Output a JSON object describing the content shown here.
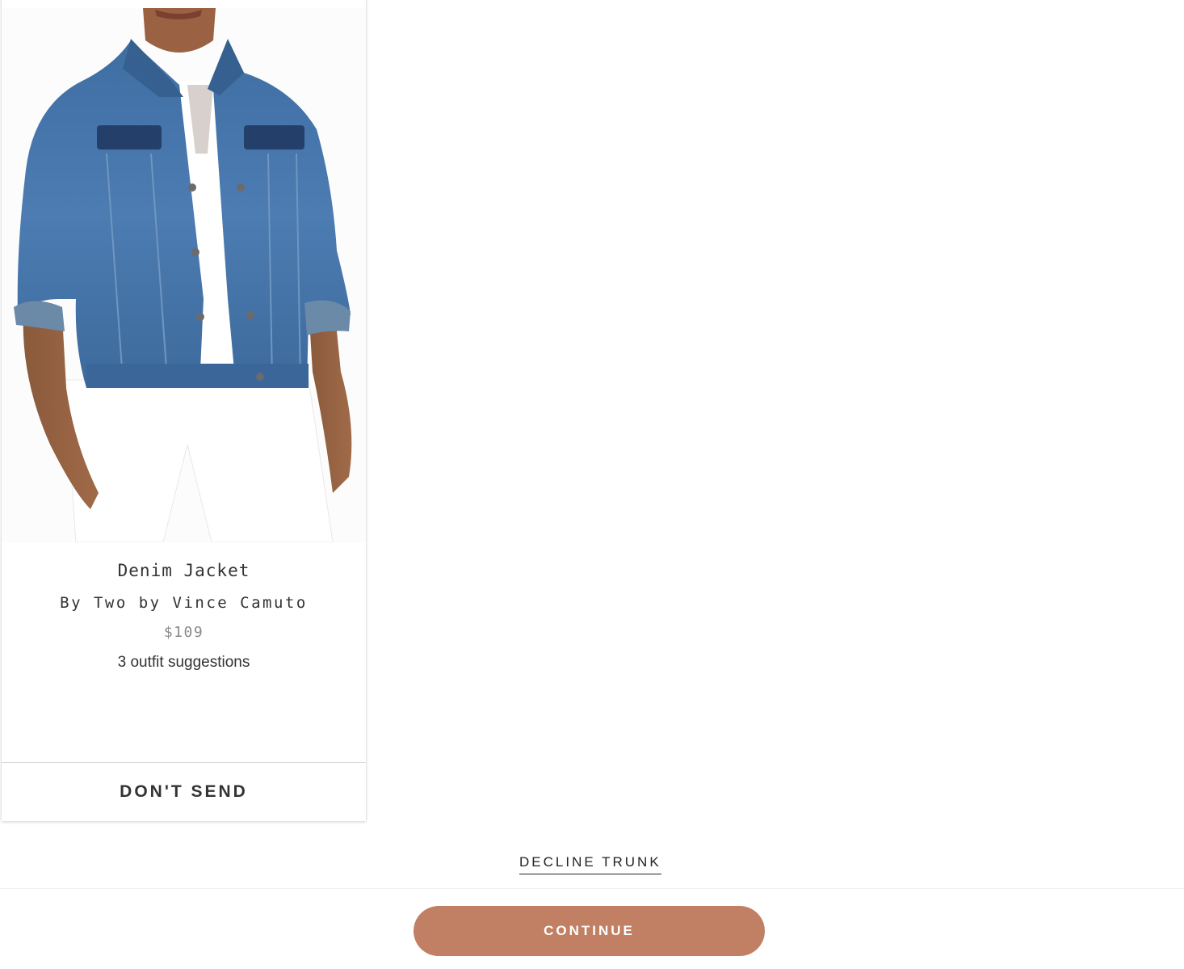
{
  "product": {
    "image_alt": "model wearing denim jacket",
    "name": "Denim Jacket",
    "brand": "By Two by Vince Camuto",
    "price": "$109",
    "outfit_link": "3 outfit suggestions",
    "dont_send_label": "DON'T SEND"
  },
  "actions": {
    "decline_label": "DECLINE TRUNK",
    "continue_label": "CONTINUE"
  },
  "colors": {
    "accent": "#c17f64",
    "denim": "#3d6b9e",
    "card_border": "#e4e4e4"
  }
}
